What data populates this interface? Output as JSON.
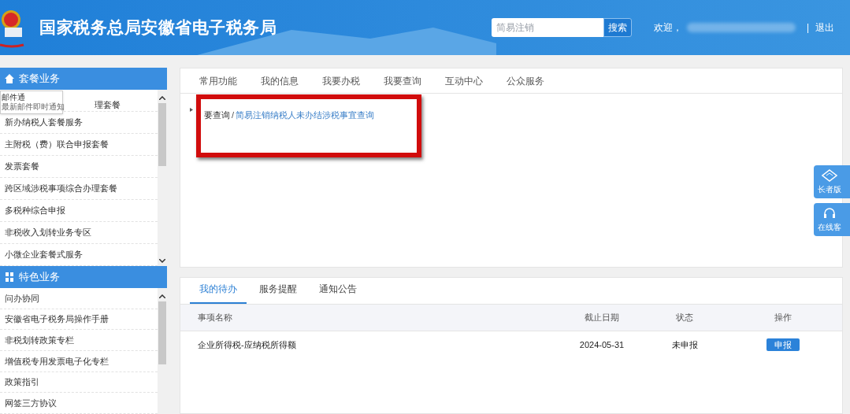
{
  "header": {
    "title": "国家税务总局安徽省电子税务局",
    "search": {
      "placeholder": "简易注销",
      "button": "搜索"
    },
    "welcome": "欢迎，",
    "separator": "|",
    "logout": "退出"
  },
  "tooltip": {
    "title": "邮件通",
    "text": "最新邮件即时通知"
  },
  "sidebar": [
    {
      "title": "套餐业务",
      "items": [
        "理套餐",
        "新办纳税人套餐服务",
        "主附税（费）联合申报套餐",
        "发票套餐",
        "跨区域涉税事项综合办理套餐",
        "多税种综合申报",
        "非税收入划转业务专区",
        "小微企业套餐式服务"
      ]
    },
    {
      "title": "特色业务",
      "items": [
        "问办协同",
        "安徽省电子税务局操作手册",
        "非税划转政策专栏",
        "增值税专用发票电子化专栏",
        "政策指引",
        "网签三方协议"
      ]
    }
  ],
  "main_tabs": [
    {
      "label": "常用功能",
      "selected": false
    },
    {
      "label": "我的信息",
      "selected": false
    },
    {
      "label": "我要办税",
      "selected": false
    },
    {
      "label": "我要查询",
      "selected": false
    },
    {
      "label": "互动中心",
      "selected": false
    },
    {
      "label": "公众服务",
      "selected": false
    }
  ],
  "breadcrumb": {
    "parent": "要查询",
    "separator": "/",
    "current": "简易注销纳税人未办结涉税事宜查询"
  },
  "side_buttons": [
    "长者版",
    "在线客"
  ],
  "todo_tabs": [
    {
      "label": "我的待办",
      "selected": true
    },
    {
      "label": "服务提醒",
      "selected": false
    },
    {
      "label": "通知公告",
      "selected": false
    }
  ],
  "table": {
    "columns": [
      "事项名称",
      "截止日期",
      "状态",
      "操作"
    ],
    "rows": [
      {
        "name": "企业所得税-应纳税所得额",
        "deadline": "2024-05-31",
        "status": "未申报",
        "action": "申报"
      }
    ]
  }
}
